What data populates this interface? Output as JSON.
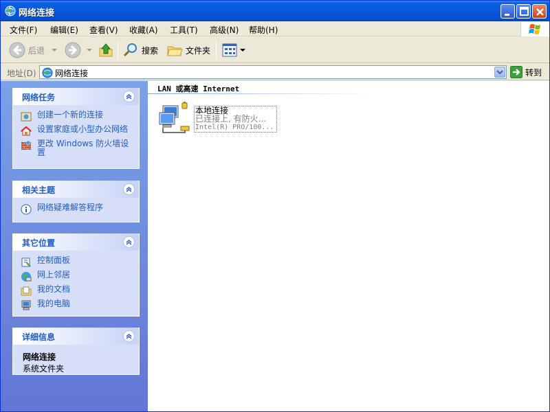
{
  "window": {
    "title": "网络连接"
  },
  "menu": {
    "items": [
      "文件(F)",
      "编辑(E)",
      "查看(V)",
      "收藏(A)",
      "工具(T)",
      "高级(N)",
      "帮助(H)"
    ]
  },
  "toolbar": {
    "back_label": "后退",
    "search_label": "搜索",
    "folders_label": "文件夹"
  },
  "address": {
    "label": "地址(D)",
    "value": "网络连接",
    "go_label": "转到"
  },
  "tasks": {
    "network": {
      "title": "网络任务",
      "items": [
        "创建一个新的连接",
        "设置家庭或小型办公网络",
        "更改 Windows 防火墙设置"
      ]
    },
    "related": {
      "title": "相关主题",
      "items": [
        "网络疑难解答程序"
      ]
    },
    "other": {
      "title": "其它位置",
      "items": [
        "控制面板",
        "网上邻居",
        "我的文档",
        "我的电脑"
      ]
    },
    "details": {
      "title": "详细信息",
      "name": "网络连接",
      "type": "系统文件夹"
    }
  },
  "content": {
    "group_title": "LAN 或高速 Internet",
    "connection": {
      "name": "本地连接",
      "status": "已连接上, 有防火...",
      "device": "Intel(R) PRO/100..."
    }
  },
  "colors": {
    "titlebar": "#0858dc",
    "link": "#215dc6",
    "panel_top": "#7ba2e7",
    "panel_bottom": "#6375d6"
  }
}
